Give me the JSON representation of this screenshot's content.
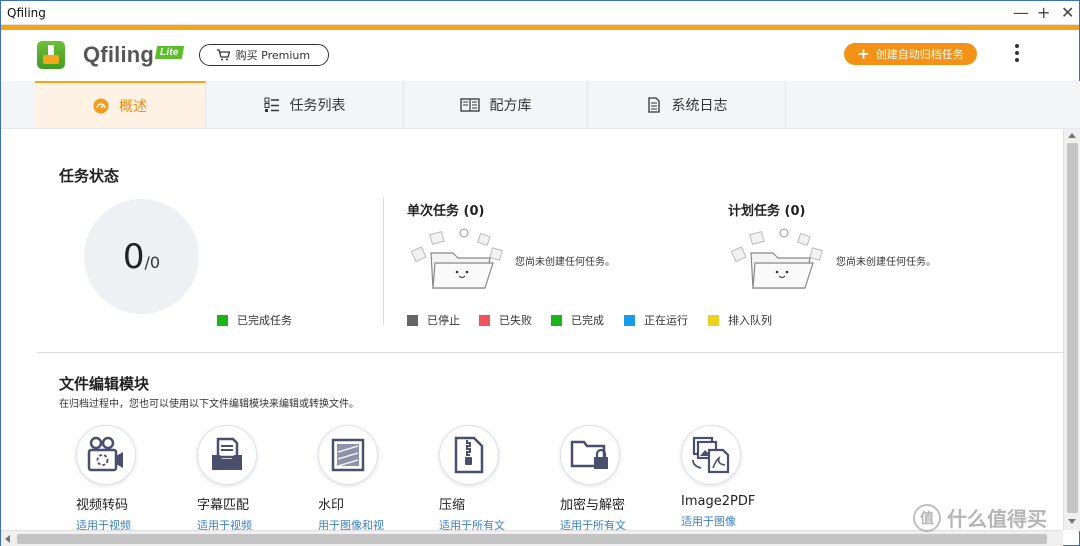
{
  "window": {
    "title": "Qfiling"
  },
  "app": {
    "brand": "Qfiling",
    "edition": "Lite",
    "premium_label": "购买 Premium",
    "create_label": "创建自动归档任务"
  },
  "tabs": [
    {
      "label": "概述",
      "active": true
    },
    {
      "label": "任务列表",
      "active": false
    },
    {
      "label": "配方库",
      "active": false
    },
    {
      "label": "系统日志",
      "active": false
    }
  ],
  "task_status": {
    "title": "任务状态",
    "done_count": "0",
    "total": "/0",
    "completed_legend": "已完成任务",
    "completed_color": "#1db31d"
  },
  "single_tasks": {
    "title": "单次任务 (0)",
    "empty": "您尚未创建任何任务。"
  },
  "scheduled_tasks": {
    "title": "计划任务 (0)",
    "empty": "您尚未创建任何任务。"
  },
  "status_legend": [
    {
      "label": "已停止",
      "color": "#666666"
    },
    {
      "label": "已失败",
      "color": "#f0545f"
    },
    {
      "label": "已完成",
      "color": "#1db31d"
    },
    {
      "label": "正在运行",
      "color": "#1a9be8"
    },
    {
      "label": "排入队列",
      "color": "#ead31e"
    }
  ],
  "modules": {
    "title": "文件编辑模块",
    "subtitle": "在归档过程中，您也可以使用以下文件编辑模块来编辑或转换文件。",
    "items": [
      {
        "name": "视频转码",
        "desc": "适用于视频",
        "icon": "video-camera-icon"
      },
      {
        "name": "字幕匹配",
        "desc": "适用于视频",
        "icon": "subtitle-tray-icon"
      },
      {
        "name": "水印",
        "desc": "用于图像和视",
        "icon": "watermark-icon"
      },
      {
        "name": "压缩",
        "desc": "适用于所有文",
        "icon": "zip-file-icon"
      },
      {
        "name": "加密与解密",
        "desc": "适用于所有文",
        "icon": "lock-folder-icon"
      },
      {
        "name": "Image2PDF",
        "desc": "适用于图像",
        "icon": "image-to-pdf-icon"
      }
    ]
  },
  "watermark_text": "什么值得买",
  "colors": {
    "accent": "#f5a318",
    "orange_button": "#f49217",
    "link_blue": "#3b7fc4"
  }
}
